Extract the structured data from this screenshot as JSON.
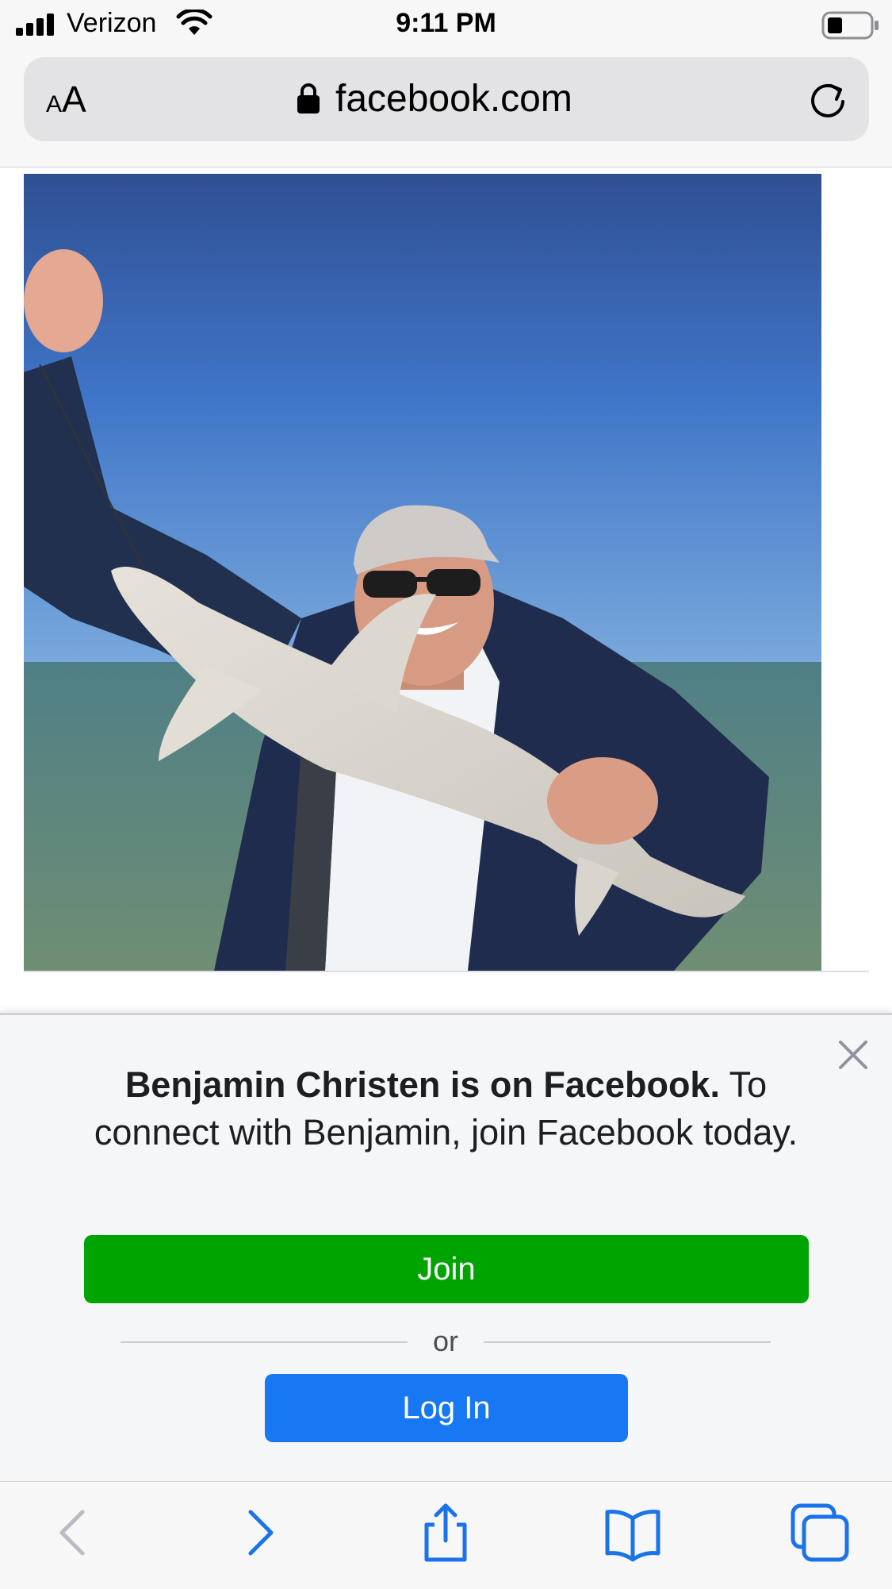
{
  "status_bar": {
    "carrier": "Verizon",
    "time": "9:11 PM"
  },
  "browser": {
    "text_size_label_small": "A",
    "text_size_label_large": "A",
    "url": "facebook.com"
  },
  "photo": {
    "icon": "man-holding-shark-photo"
  },
  "join_prompt": {
    "headline": "Benjamin Christen is on Facebook.",
    "body": " To connect with Benjamin, join Facebook today.",
    "join_label": "Join",
    "or_label": "or",
    "login_label": "Log In",
    "colors": {
      "join": "#00a400",
      "login": "#1877f2"
    }
  },
  "toolbar": {
    "icons": [
      "back-icon",
      "forward-icon",
      "share-icon",
      "bookmarks-icon",
      "tabs-icon"
    ]
  }
}
